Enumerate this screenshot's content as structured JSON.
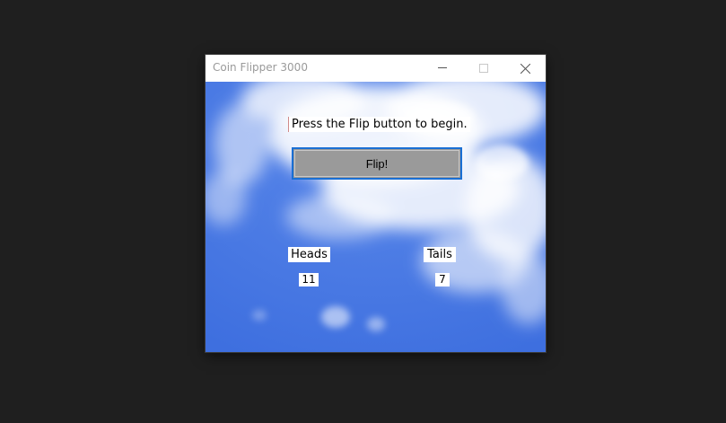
{
  "window": {
    "title": "Coin Flipper 3000"
  },
  "status": {
    "message": "Press the Flip button to begin."
  },
  "flip_button": {
    "label": "Flip!"
  },
  "scores": {
    "heads_label": "Heads",
    "heads_count": "11",
    "tails_label": "Tails",
    "tails_count": "7"
  },
  "colors": {
    "desktop": "#1f1f1f",
    "sky_blue": "#4a79e4",
    "button_gray": "#9a9a9a",
    "button_focus_border": "#1a6fd4"
  }
}
